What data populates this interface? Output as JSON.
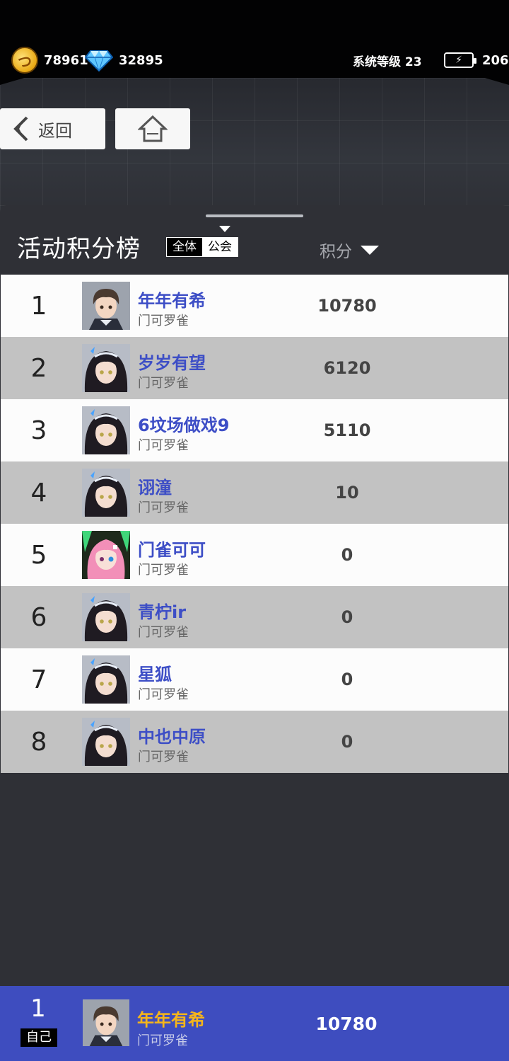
{
  "topbar": {
    "coins": "78961",
    "gems": "32895",
    "system_level": "系统等级 23",
    "energy": "206"
  },
  "nav": {
    "back_label": "返回"
  },
  "panel": {
    "title": "活动积分榜",
    "filter_all": "全体",
    "filter_guild": "公会",
    "score_header": "积分"
  },
  "rows": [
    {
      "rank": "1",
      "name": "年年有希",
      "guild": "门可罗雀",
      "score": "10780",
      "avatar": "male-portrait-icon"
    },
    {
      "rank": "2",
      "name": "岁岁有望",
      "guild": "门可罗雀",
      "score": "6120",
      "avatar": "girl-portrait-icon"
    },
    {
      "rank": "3",
      "name": "6坟场做戏9",
      "guild": "门可罗雀",
      "score": "5110",
      "avatar": "girl-portrait-icon"
    },
    {
      "rank": "4",
      "name": "诩潼",
      "guild": "门可罗雀",
      "score": "10",
      "avatar": "girl-portrait-icon"
    },
    {
      "rank": "5",
      "name": "门雀可可",
      "guild": "门可罗雀",
      "score": "0",
      "avatar": "pink-hair-portrait-icon"
    },
    {
      "rank": "6",
      "name": "青柠ir",
      "guild": "门可罗雀",
      "score": "0",
      "avatar": "girl-portrait-icon"
    },
    {
      "rank": "7",
      "name": "星狐",
      "guild": "门可罗雀",
      "score": "0",
      "avatar": "girl-portrait-icon"
    },
    {
      "rank": "8",
      "name": "中也中原",
      "guild": "门可罗雀",
      "score": "0",
      "avatar": "girl-portrait-icon"
    }
  ],
  "self": {
    "rank": "1",
    "tag": "自己",
    "name": "年年有希",
    "guild": "门可罗雀",
    "score": "10780"
  },
  "colors": {
    "name_blue": "#3d4ec6",
    "self_bar": "#3e4dbf",
    "self_name": "#f5b51a",
    "row_dark": "#c2c2c2",
    "row_light": "#fcfcfc"
  }
}
